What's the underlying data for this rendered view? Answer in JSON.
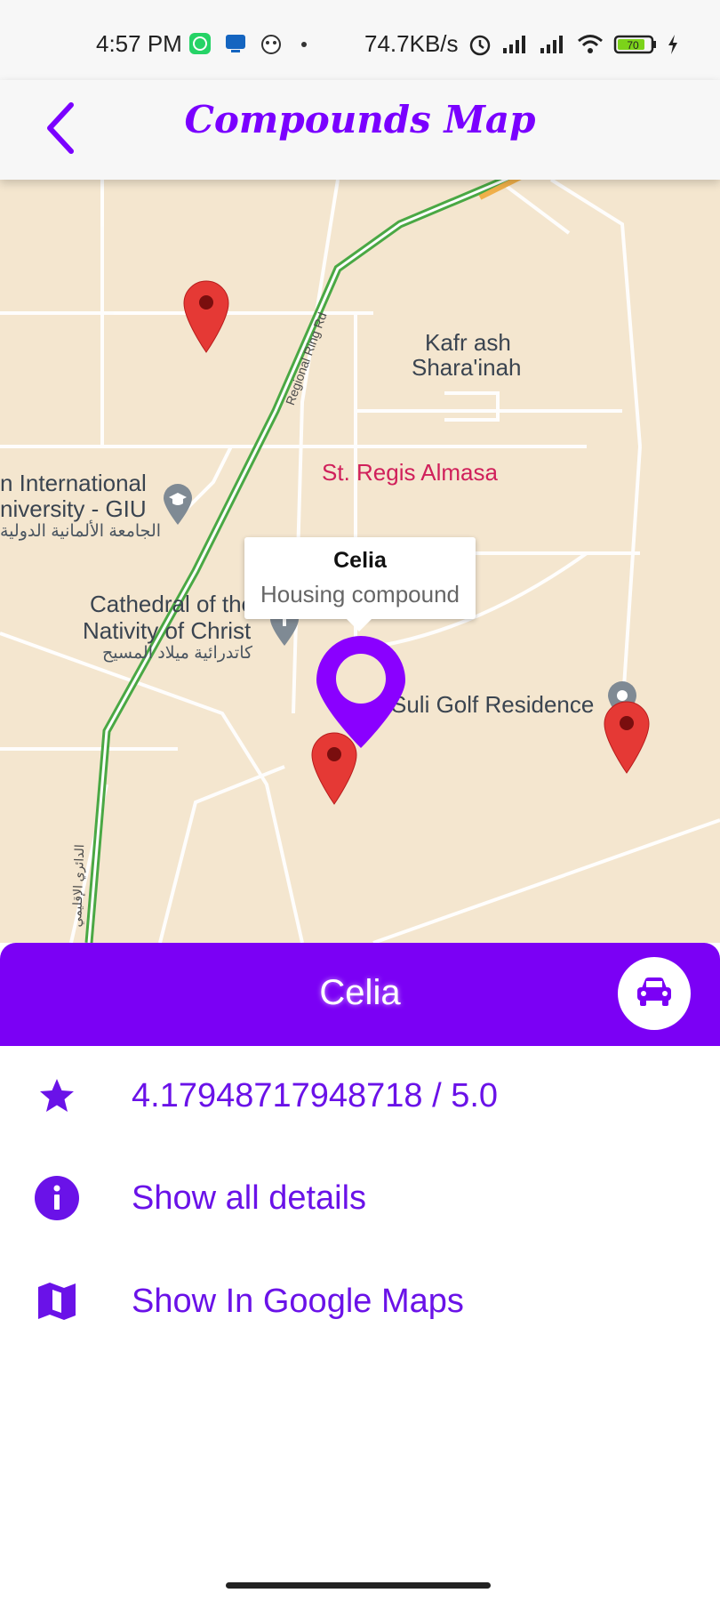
{
  "status_bar": {
    "time": "4:57 PM",
    "net_speed": "74.7KB/s",
    "battery_level": "70",
    "icons": [
      "whatsapp-icon",
      "notification-icon",
      "app-icon",
      "dot-icon",
      "alarm-icon",
      "signal-icon",
      "signal-icon",
      "wifi-icon",
      "battery-icon",
      "charging-icon"
    ]
  },
  "app_bar": {
    "title": "Compounds Map",
    "back_icon": "chevron-left-icon"
  },
  "map": {
    "labels": {
      "kafr_line1": "Kafr ash",
      "kafr_line2": "Shara'inah",
      "giu_line1": "n International",
      "giu_line2": "niversity - GIU",
      "giu_ar": "الجامعة الألمانية الدولية",
      "cathedral_line1": "Cathedral of the",
      "cathedral_line2": "Nativity of Christ",
      "cathedral_ar": "كاتدرائية ميلاد المسيح",
      "suli": "Suli Golf Residence",
      "st_place": "St. Regis Almasa",
      "road": "Regional Ring Rd",
      "road_ar": "الدائري الإقليمي"
    },
    "info_window": {
      "title": "Celia",
      "subtitle": "Housing compound"
    },
    "colors": {
      "land": "#f4e6cf",
      "road": "#ffffff",
      "highway": "#5cb85c",
      "marker_red": "#e53935",
      "marker_selected": "#8a00ff"
    }
  },
  "sheet": {
    "title": "Celia",
    "car_icon": "car-icon",
    "options": [
      {
        "icon": "star-icon",
        "label": "4.17948717948718 / 5.0"
      },
      {
        "icon": "info-icon",
        "label": "Show all details"
      },
      {
        "icon": "map-icon",
        "label": "Show In Google Maps"
      }
    ],
    "accent": "#7b00f5"
  }
}
